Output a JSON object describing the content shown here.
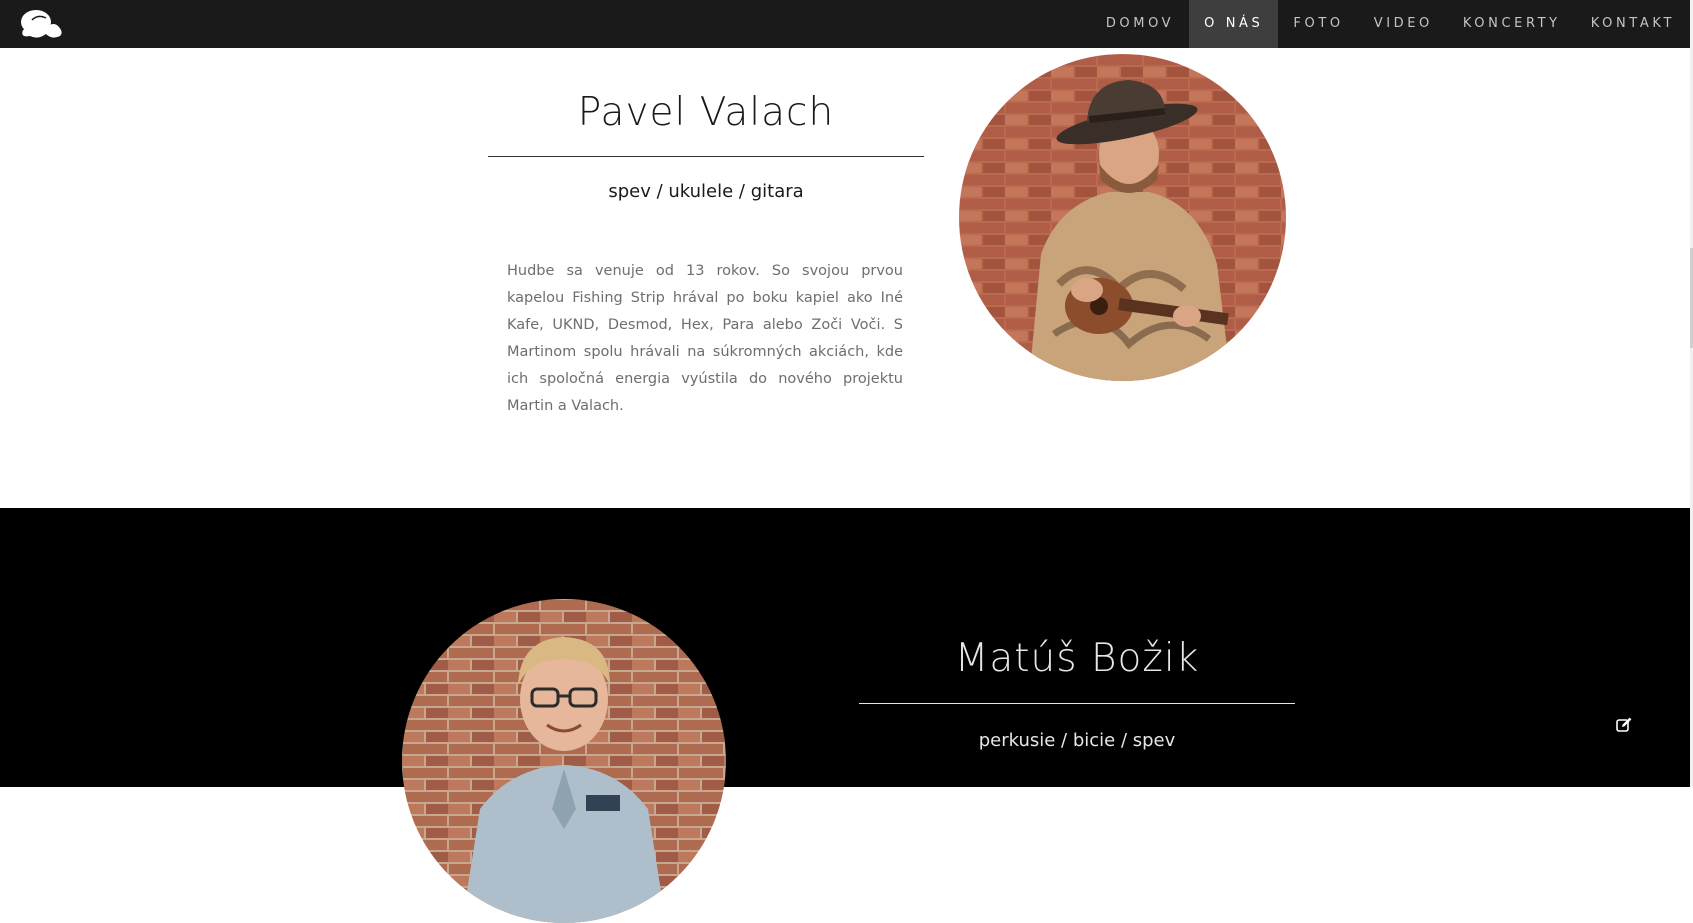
{
  "nav": {
    "items": [
      {
        "label": "DOMOV",
        "active": false
      },
      {
        "label": "O NÁS",
        "active": true
      },
      {
        "label": "FOTO",
        "active": false
      },
      {
        "label": "VIDEO",
        "active": false
      },
      {
        "label": "KONCERTY",
        "active": false
      },
      {
        "label": "KONTAKT",
        "active": false
      }
    ]
  },
  "members": [
    {
      "name": "Pavel Valach",
      "role": "spev / ukulele / gitara",
      "bio": "Hudbe sa venuje od 13 rokov. So svojou prvou kapelou Fishing Strip hrával po boku kapiel ako Iné Kafe, UKND, Desmod, Hex, Para alebo Zoči Voči. S Martinom spolu hrávali na súkromných akciách, kde ich spoločná energia vyústila do nového projektu Martin a Valach.",
      "photo_icon": "ukulele-player-photo"
    },
    {
      "name": "Matúš Božik",
      "role": "perkusie / bicie / spev",
      "photo_icon": "drummer-portrait-photo"
    }
  ],
  "colors": {
    "nav_bg": "#1a1a1a",
    "nav_active_bg": "#3e3e3e",
    "section_light_bg": "#ffffff",
    "section_dark_bg": "#000000",
    "text_dark": "#1a1a1a",
    "text_light": "#e6e6e6",
    "bio_text": "#6e6e6e"
  }
}
